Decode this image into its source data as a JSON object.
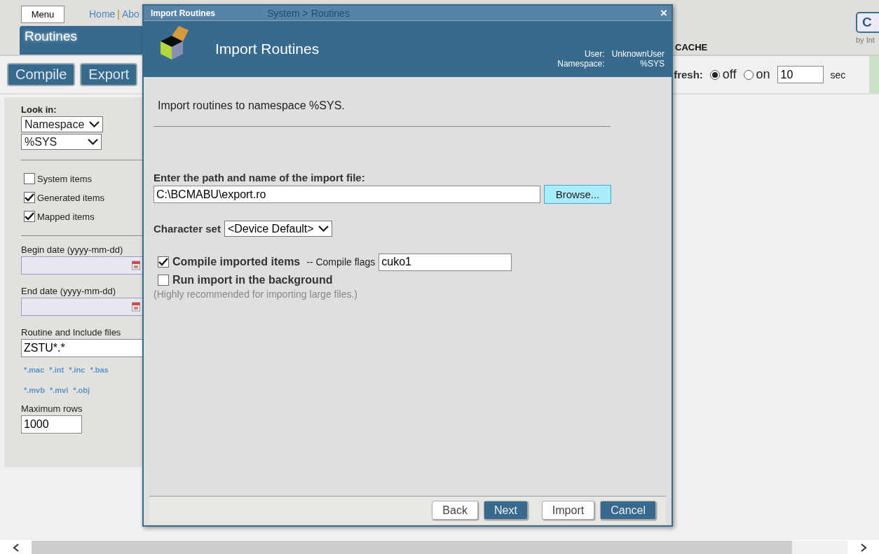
{
  "page": {
    "menu_button": "Menu",
    "nav_links": [
      "Home",
      "Abo"
    ],
    "nav_separator": "|",
    "breadcrumb": "System > Routines",
    "page_tab": "Routines",
    "brand_label": "CACHE",
    "logo_text": "C",
    "logo_caption": "by Int",
    "actions": [
      "Compile",
      "Export"
    ],
    "refresh": {
      "label": "fresh:",
      "options": [
        {
          "label": "off",
          "selected": true
        },
        {
          "label": "on",
          "selected": false
        }
      ],
      "interval": "10",
      "unit": "sec"
    }
  },
  "sidebar": {
    "look_in_label": "Look in:",
    "look_in": "Namespace",
    "namespace": "%SYS",
    "filters": [
      {
        "label": "System items",
        "checked": false
      },
      {
        "label": "Generated items",
        "checked": true
      },
      {
        "label": "Mapped items",
        "checked": true
      }
    ],
    "begin_date_label": "Begin date (yyyy-mm-dd)",
    "end_date_label": "End date (yyyy-mm-dd)",
    "files_label": "Routine and Include files",
    "files_value": "ZSTU*.*",
    "extensions": [
      [
        "*.mac",
        "*.int",
        "*.inc",
        "*.bas"
      ],
      [
        "*.mvb",
        "*.mvi",
        "*.obj"
      ]
    ],
    "max_rows_label": "Maximum rows",
    "max_rows": "1000"
  },
  "dialog": {
    "title": "Import Routines",
    "close": "×",
    "heading": "Import Routines",
    "user_label": "User:",
    "user": "UnknownUser",
    "namespace_label": "Namespace:",
    "namespace": "%SYS",
    "intro": "Import routines to namespace %SYS.",
    "file_label": "Enter the path and name of the import file:",
    "file_value": "C:\\BCMABU\\export.ro",
    "browse": "Browse...",
    "charset_label": "Character set",
    "charset": "<Device Default>",
    "options": [
      {
        "label": "Compile imported items",
        "checked": true,
        "flags_label": "-- Compile flags",
        "flags_value": "cuko1"
      },
      {
        "label": "Run import in the background",
        "checked": false
      }
    ],
    "note": "(Highly recommended for importing large files.)",
    "buttons": [
      {
        "label": "Back",
        "kind": "plain"
      },
      {
        "label": "Next",
        "kind": "primary"
      },
      {
        "label": "Import",
        "kind": "plain"
      },
      {
        "label": "Cancel",
        "kind": "primary"
      }
    ]
  }
}
